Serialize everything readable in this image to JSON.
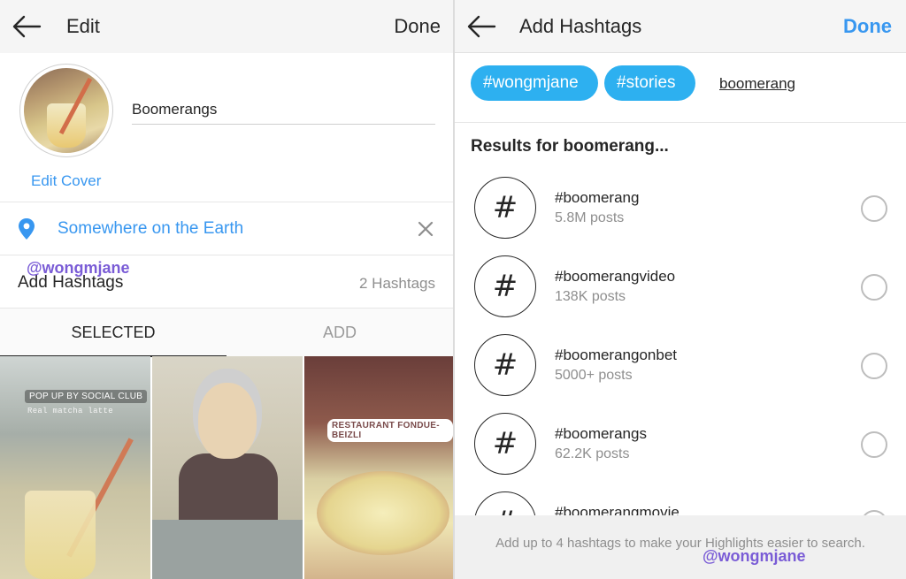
{
  "edit_screen": {
    "header": {
      "title": "Edit",
      "done_label": "Done"
    },
    "cover": {
      "edit_label": "Edit Cover"
    },
    "highlight_name": "Boomerangs",
    "location": {
      "text": "Somewhere on the Earth"
    },
    "hashtags_row": {
      "label": "Add Hashtags",
      "count": "2 Hashtags"
    },
    "watermark": "@wongmjane",
    "tabs": [
      {
        "label": "SELECTED"
      },
      {
        "label": "ADD"
      }
    ],
    "thumbnails": [
      {
        "sticker": "POP UP BY SOCIAL CLUB",
        "caption": "Real matcha latte"
      },
      {
        "sticker": ""
      },
      {
        "sticker": "RESTAURANT FONDUE-BEIZLI"
      }
    ]
  },
  "hashtags_screen": {
    "header": {
      "title": "Add Hashtags",
      "done_label": "Done"
    },
    "selected_chips": [
      "#wongmjane",
      "#stories"
    ],
    "query": "boomerang",
    "results_title": "Results for boomerang...",
    "results": [
      {
        "icon": "hashtag-icon",
        "name": "#boomerang",
        "count": "5.8M posts"
      },
      {
        "icon": "hashtag-icon",
        "name": "#boomerangvideo",
        "count": "138K posts"
      },
      {
        "icon": "hashtag-icon",
        "name": "#boomerangonbet",
        "count": "5000+ posts"
      },
      {
        "icon": "hashtag-icon",
        "name": "#boomerangs",
        "count": "62.2K posts"
      },
      {
        "icon": "hashtag-icon",
        "name": "#boomerangmovie",
        "count": ""
      }
    ],
    "footer_text": "Add up to 4 hashtags to make your Highlights easier to search.",
    "watermark": "@wongmjane"
  },
  "colors": {
    "accent_blue": "#3897f0",
    "chip_blue": "#2db0f0",
    "watermark_purple": "#7a5cd6"
  }
}
